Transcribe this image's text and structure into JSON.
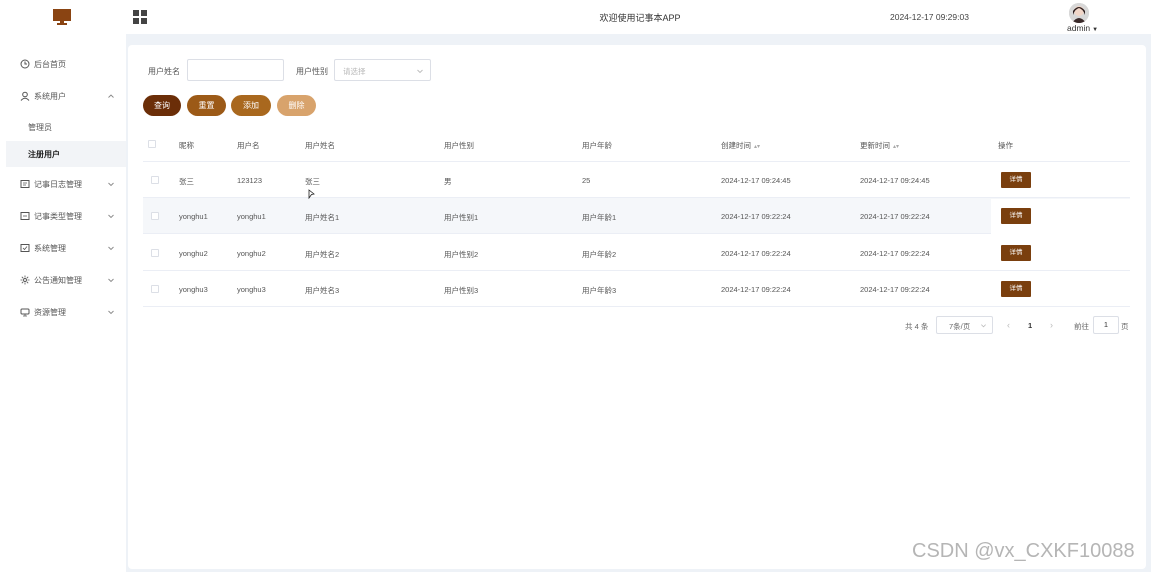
{
  "header": {
    "title": "欢迎使用记事本APP",
    "datetime": "2024-12-17 09:29:03",
    "user": "admin"
  },
  "sidebar": {
    "items": [
      {
        "label": "后台首页",
        "icon": "clock-icon"
      },
      {
        "label": "系统用户",
        "icon": "user-icon",
        "expanded": true
      },
      {
        "label": "管理员",
        "sub": true
      },
      {
        "label": "注册用户",
        "sub": true,
        "active": true
      },
      {
        "label": "记事日志管理",
        "icon": "log-icon"
      },
      {
        "label": "记事类型管理",
        "icon": "type-icon"
      },
      {
        "label": "系统管理",
        "icon": "system-icon"
      },
      {
        "label": "公告通知管理",
        "icon": "notice-icon"
      },
      {
        "label": "资源管理",
        "icon": "resource-icon"
      }
    ]
  },
  "search": {
    "name_label": "用户姓名",
    "gender_label": "用户性别",
    "gender_placeholder": "请选择"
  },
  "buttons": {
    "query": "查询",
    "reset": "重置",
    "add": "添加",
    "delete": "删除"
  },
  "table": {
    "columns": [
      "昵称",
      "用户名",
      "用户姓名",
      "用户性别",
      "用户年龄",
      "创建时间",
      "更新时间",
      "操作"
    ],
    "rows": [
      {
        "nickname": "张三",
        "username": "123123",
        "realname": "张三",
        "gender": "男",
        "age": "25",
        "created": "2024-12-17 09:24:45",
        "updated": "2024-12-17 09:24:45"
      },
      {
        "nickname": "yonghu1",
        "username": "yonghu1",
        "realname": "用户姓名1",
        "gender": "用户性别1",
        "age": "用户年龄1",
        "created": "2024-12-17 09:22:24",
        "updated": "2024-12-17 09:22:24"
      },
      {
        "nickname": "yonghu2",
        "username": "yonghu2",
        "realname": "用户姓名2",
        "gender": "用户性别2",
        "age": "用户年龄2",
        "created": "2024-12-17 09:22:24",
        "updated": "2024-12-17 09:22:24"
      },
      {
        "nickname": "yonghu3",
        "username": "yonghu3",
        "realname": "用户姓名3",
        "gender": "用户性别3",
        "age": "用户年龄3",
        "created": "2024-12-17 09:22:24",
        "updated": "2024-12-17 09:22:24"
      }
    ],
    "detail_label": "详情"
  },
  "pagination": {
    "total": "共 4 条",
    "page_size": "7条/页",
    "current": "1",
    "goto_prefix": "前往",
    "goto_value": "1",
    "goto_suffix": "页"
  },
  "watermark": "CSDN @vx_CXKF10088",
  "colors": {
    "brand_dark": "#6b2e08",
    "brand": "#9c5a17",
    "brand_light": "#d8a36c"
  }
}
